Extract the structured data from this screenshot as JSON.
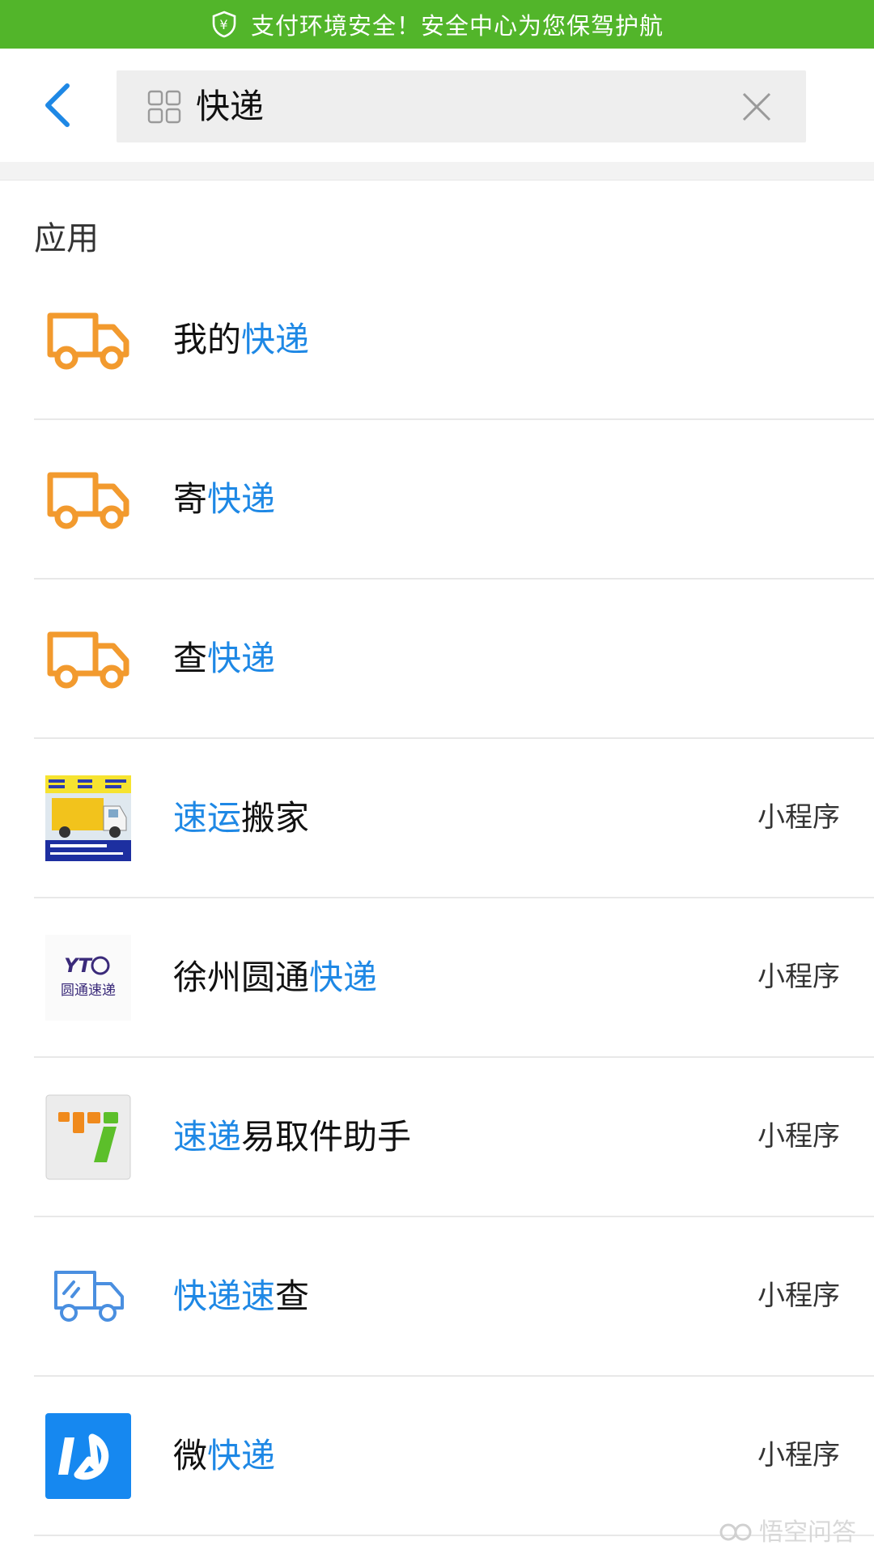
{
  "banner": {
    "text": "支付环境安全！安全中心为您保驾护航",
    "color": "#52b52a"
  },
  "header": {
    "back_icon": "chevron-left-icon",
    "search": {
      "query": "快递",
      "apps_icon": "grid-icon",
      "clear_icon": "close-icon"
    }
  },
  "section": {
    "title": "应用"
  },
  "results": [
    {
      "prefix": "我的",
      "highlight": "快递",
      "suffix": "",
      "tag": "",
      "icon": "truck-icon"
    },
    {
      "prefix": "寄",
      "highlight": "快递",
      "suffix": "",
      "tag": "",
      "icon": "truck-icon"
    },
    {
      "prefix": "查",
      "highlight": "快递",
      "suffix": "",
      "tag": "",
      "icon": "truck-icon"
    },
    {
      "prefix": "",
      "highlight": "速运",
      "suffix": "搬家",
      "tag": "小程序",
      "icon": "moving-truck-photo"
    },
    {
      "prefix": "徐州圆通",
      "highlight": "快递",
      "suffix": "",
      "tag": "小程序",
      "icon": "yto-logo",
      "logo_mark": "YT",
      "logo_text": "圆通速递"
    },
    {
      "prefix": "",
      "highlight": "速递",
      "suffix": "易取件助手",
      "tag": "小程序",
      "icon": "stripe-logo"
    },
    {
      "prefix": "",
      "highlight": "快递速",
      "suffix": "查",
      "tag": "小程序",
      "icon": "outline-truck-icon"
    },
    {
      "prefix": "微",
      "highlight": "快递",
      "suffix": "",
      "tag": "小程序",
      "icon": "blue-square-logo"
    }
  ],
  "watermark": {
    "text": "悟空问答"
  },
  "colors": {
    "accent": "#1e88e5",
    "truck_orange": "#f29a2e"
  }
}
